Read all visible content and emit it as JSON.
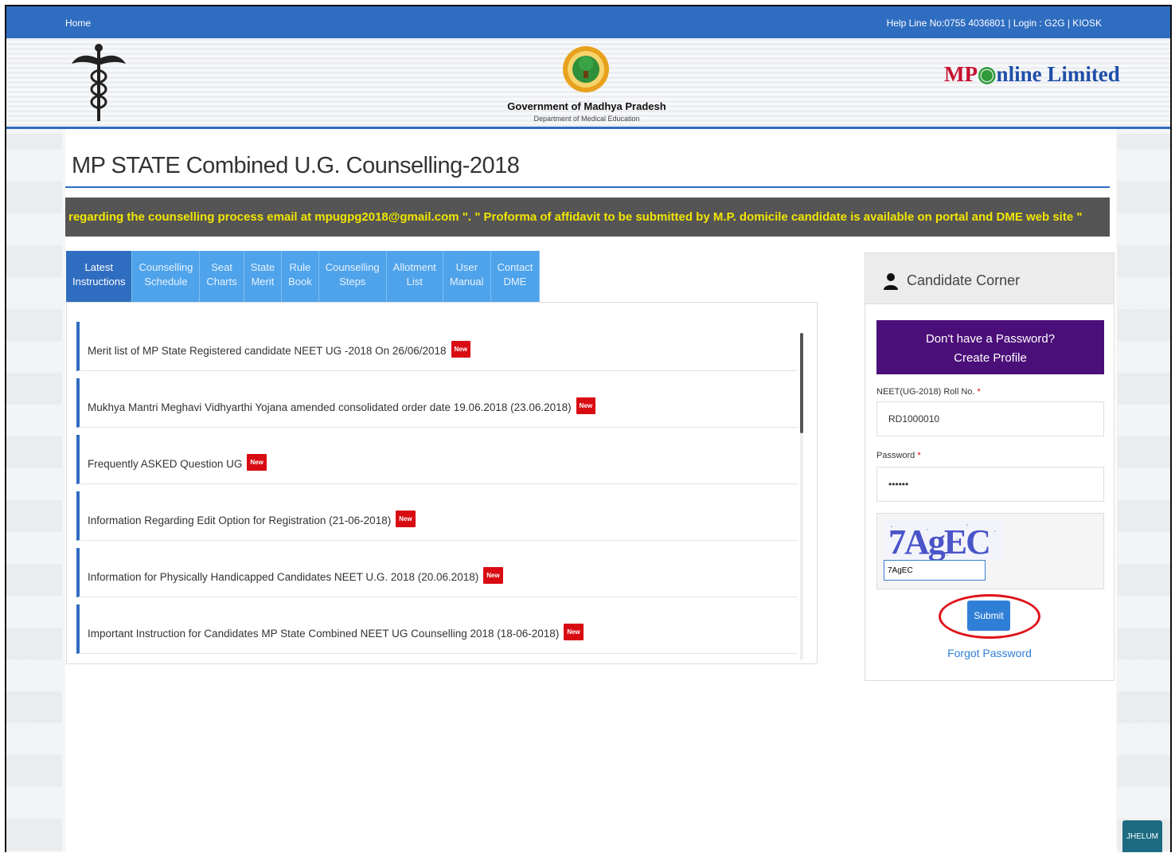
{
  "topbar": {
    "home": "Home",
    "help": "Help Line No:0755 4036801 | Login : G2G | KIOSK"
  },
  "header": {
    "gov_title": "Government of Madhya Pradesh",
    "gov_sub": "Department of Medical Education",
    "brand_mp": "MP",
    "brand_rest": "nline Limited"
  },
  "page": {
    "title": "MP STATE Combined U.G. Counselling-2018",
    "marquee": "regarding the counselling process email at mpugpg2018@gmail.com \". \" Proforma of affidavit to be submitted by M.P. domicile candidate is available on portal and DME web site \""
  },
  "tabs": [
    {
      "l1": "Latest",
      "l2": "Instructions"
    },
    {
      "l1": "Counselling",
      "l2": "Schedule"
    },
    {
      "l1": "Seat",
      "l2": "Charts"
    },
    {
      "l1": "State",
      "l2": "Merit"
    },
    {
      "l1": "Rule",
      "l2": "Book"
    },
    {
      "l1": "Counselling",
      "l2": "Steps"
    },
    {
      "l1": "Allotment",
      "l2": "List"
    },
    {
      "l1": "User",
      "l2": "Manual"
    },
    {
      "l1": "Contact",
      "l2": "DME"
    }
  ],
  "news": [
    {
      "text": "Merit list of MP State Registered candidate NEET UG -2018 On 26/06/2018",
      "badge": "New"
    },
    {
      "text": "Mukhya Mantri Meghavi Vidhyarthi Yojana amended consolidated order date 19.06.2018 (23.06.2018)",
      "badge": "New"
    },
    {
      "text": "Frequently ASKED Question UG",
      "badge": "New"
    },
    {
      "text": "Information Regarding Edit Option for Registration (21-06-2018)",
      "badge": "New"
    },
    {
      "text": "Information for Physically Handicapped Candidates NEET U.G. 2018 (20.06.2018)",
      "badge": "New"
    },
    {
      "text": "Important Instruction for Candidates MP State Combined NEET UG Counselling 2018 (18-06-2018)",
      "badge": "New"
    }
  ],
  "corner": {
    "title": "Candidate Corner",
    "create_l1": "Don't have a Password?",
    "create_l2": "Create Profile",
    "roll_label": "NEET(UG-2018) Roll No.",
    "roll_value": "RD1000010",
    "password_label": "Password",
    "password_value": "••••••",
    "required": "*",
    "captcha_text": "7AgEC",
    "captcha_input": "7AgEC",
    "submit": "Submit",
    "forgot": "Forgot Password"
  },
  "footer_badge": "JHELUM"
}
